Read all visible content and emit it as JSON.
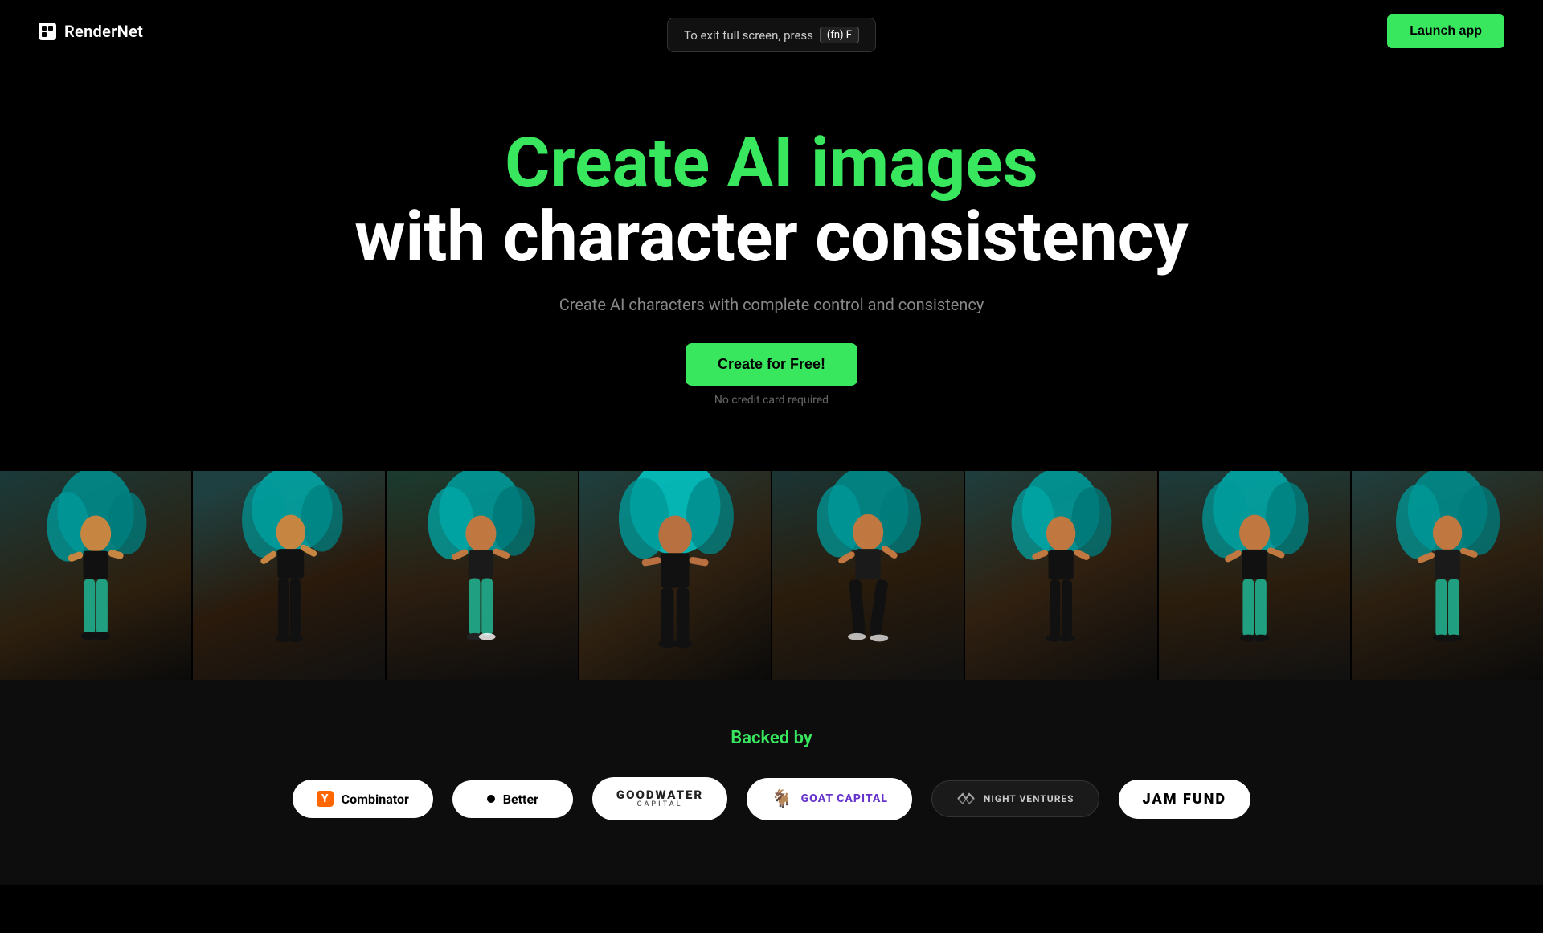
{
  "brand": {
    "name": "RenderNet",
    "logo_text": "RenderNet"
  },
  "navbar": {
    "toast_prefix": "To exit full screen, press",
    "toast_key": "(fn) F",
    "launch_btn": "Launch app"
  },
  "hero": {
    "title_line1": "Create AI images",
    "title_line2": "with character consistency",
    "subtitle": "Create AI characters with complete control and consistency",
    "cta_button": "Create for Free!",
    "cta_note": "No credit card required"
  },
  "backers": {
    "label": "Backed by",
    "items": [
      {
        "id": "ycombinator",
        "name": "Y Combinator",
        "display": "Y Combinator"
      },
      {
        "id": "better",
        "name": "Better",
        "display": "Better"
      },
      {
        "id": "goodwater",
        "name": "Goodwater Capital",
        "display": "GOODWATER"
      },
      {
        "id": "goatcapital",
        "name": "Goat Capital",
        "display": "GOAT CAPITAL"
      },
      {
        "id": "nightventures",
        "name": "Night Ventures",
        "display": "NIGHT VENTURES"
      },
      {
        "id": "jamfund",
        "name": "Jam Fund",
        "display": "JAM FUND"
      }
    ]
  },
  "images": {
    "strip_count": 8,
    "description": "AI-generated images of woman with teal curly hair in urban settings"
  }
}
